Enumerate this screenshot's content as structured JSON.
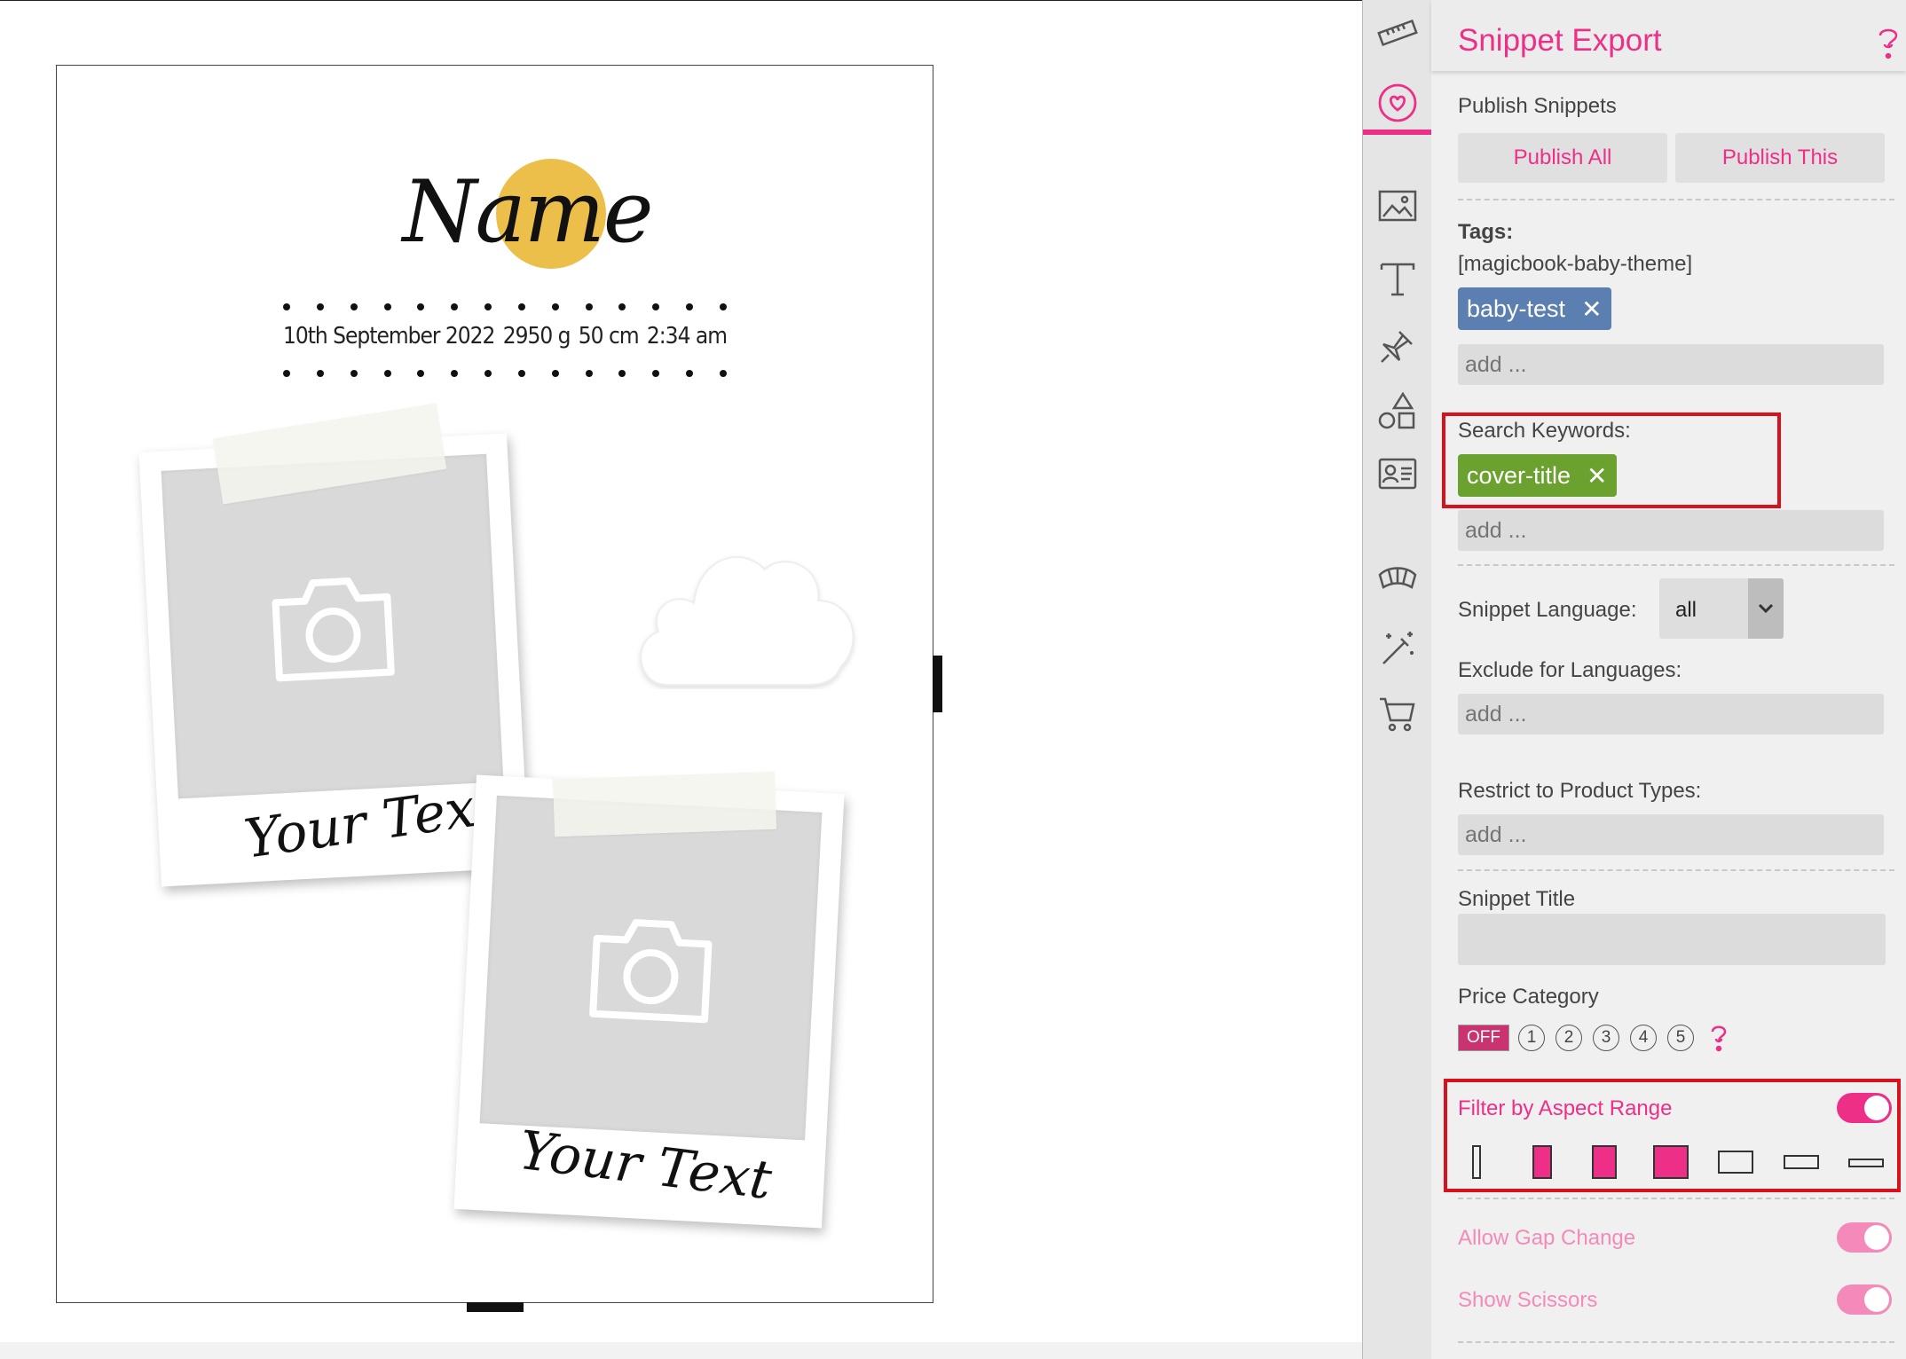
{
  "canvas": {
    "name_title": "Name",
    "birth_info": [
      "10th September 2022",
      "2950 g",
      "50 cm",
      "2:34 am"
    ],
    "photo_captions": [
      "Your Text",
      "Your Text"
    ]
  },
  "toolbar": {
    "tools": [
      "ruler-icon",
      "heart-icon",
      "image-icon",
      "text-icon",
      "pin-icon",
      "shapes-icon",
      "contact-card-icon",
      "layout-icon",
      "magic-wand-icon",
      "cart-icon"
    ],
    "active_tool": "heart-icon"
  },
  "panel": {
    "title": "Snippet Export",
    "publish_section_label": "Publish Snippets",
    "publish_all_label": "Publish All",
    "publish_this_label": "Publish This",
    "tags_label": "Tags:",
    "tags_value": "[magicbook-baby-theme]",
    "tag_chip": "baby-test",
    "tags_placeholder": "add ...",
    "keywords_label": "Search Keywords:",
    "keyword_chip": "cover-title",
    "keywords_placeholder": "add ...",
    "language_label": "Snippet Language:",
    "language_value": "all",
    "exclude_label": "Exclude for Languages:",
    "exclude_placeholder": "add ...",
    "restrict_label": "Restrict to Product Types:",
    "restrict_placeholder": "add ...",
    "snippet_title_label": "Snippet Title",
    "snippet_title_value": "",
    "price_label": "Price Category",
    "price_off": "OFF",
    "price_options": [
      "1",
      "2",
      "3",
      "4",
      "5"
    ],
    "aspect_label": "Filter by Aspect Range",
    "aspect_enabled": true,
    "gap_label": "Allow Gap Change",
    "scissors_label": "Show Scissors"
  },
  "colors": {
    "accent": "#ee2f88",
    "tag_chip": "#5b7fb0",
    "keyword_chip": "#6aa12f",
    "name_circle": "#ebbf4a",
    "highlight": "#d8121c"
  }
}
